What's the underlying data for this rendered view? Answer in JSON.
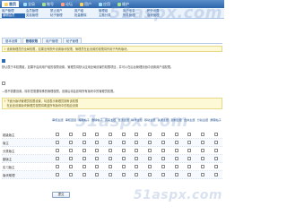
{
  "topnav": [
    {
      "label": "首页",
      "active": true
    },
    {
      "label": "全局",
      "active": false
    },
    {
      "label": "账号",
      "active": false
    },
    {
      "label": "论坛",
      "active": false
    },
    {
      "label": "用户",
      "active": false
    },
    {
      "label": "应用",
      "active": false
    },
    {
      "label": "维护",
      "active": false
    }
  ],
  "subnav": [
    "用户管理",
    "会员管理",
    "禁止用户",
    "用户组",
    "管理组",
    "用户信息",
    "积分设置",
    "编辑会员",
    "奖惩管理",
    "帖子管理",
    "批量删除",
    "主题分类",
    "附件管理",
    "版块管理"
  ],
  "subnav_active_index": 7,
  "tabs": [
    "基本设置",
    "管理权限",
    "用户管理",
    "帖子管理"
  ],
  "tabs_active_index": 1,
  "notice1": {
    "warn": "!",
    "text": "设置管理员的全局权限，如果没有额外设置版块权限，管理员在此设置的权限将作用于所有版块。"
  },
  "option1": {
    "text": "默认属于本权限组，如果不启用用户组的权限设置，管理员将默认应用全局设置的权限项目，并可以在后台管理页面中设置用户组权限。"
  },
  "option2": {
    "text": "—般不需要设置，除非您需要特殊的管理权限，设置后将会影响所有版块中的管理员权限。"
  },
  "notice2": {
    "warn": "!",
    "lines": [
      "下面为版块管理员权限设置，勾选表示管理员拥有该权限",
      "在此处设置版块管理员权限将覆盖所有版块中的相应设置"
    ]
  },
  "grid": {
    "columns": [
      "审核主题",
      "审核回复",
      "编辑帖子",
      "删除帖子",
      "高亮主题",
      "置顶主题",
      "精华主题",
      "移动主题",
      "关闭主题",
      "复制主题",
      "合并主题",
      "分割主题",
      "屏蔽帖子"
    ],
    "rows": [
      {
        "label": "超级版主",
        "checks": [
          true,
          true,
          true,
          true,
          true,
          true,
          true,
          true,
          true,
          true,
          true,
          true,
          true
        ]
      },
      {
        "label": "版主",
        "checks": [
          true,
          true,
          true,
          true,
          true,
          true,
          true,
          true,
          true,
          true,
          true,
          true,
          true
        ]
      },
      {
        "label": "分类版主",
        "checks": [
          true,
          true,
          true,
          true,
          true,
          true,
          true,
          true,
          true,
          true,
          true,
          true,
          true
        ]
      },
      {
        "label": "副版主",
        "checks": [
          true,
          true,
          true,
          true,
          true,
          true,
          true,
          true,
          true,
          true,
          true,
          true,
          true
        ]
      },
      {
        "label": "实习版主",
        "checks": [
          true,
          true,
          true,
          true,
          true,
          true,
          true,
          true,
          true,
          true,
          true,
          true,
          true
        ]
      },
      {
        "label": "版块助理",
        "checks": [
          true,
          true,
          true,
          true,
          true,
          true,
          true,
          true,
          true,
          true,
          true,
          true,
          true
        ]
      }
    ]
  },
  "submit_label": "提交",
  "watermark": "51aspx.com",
  "colors": {
    "header": "#2b66ab",
    "accent": "#2c69b3",
    "notice_bg": "#fdf9d7"
  }
}
